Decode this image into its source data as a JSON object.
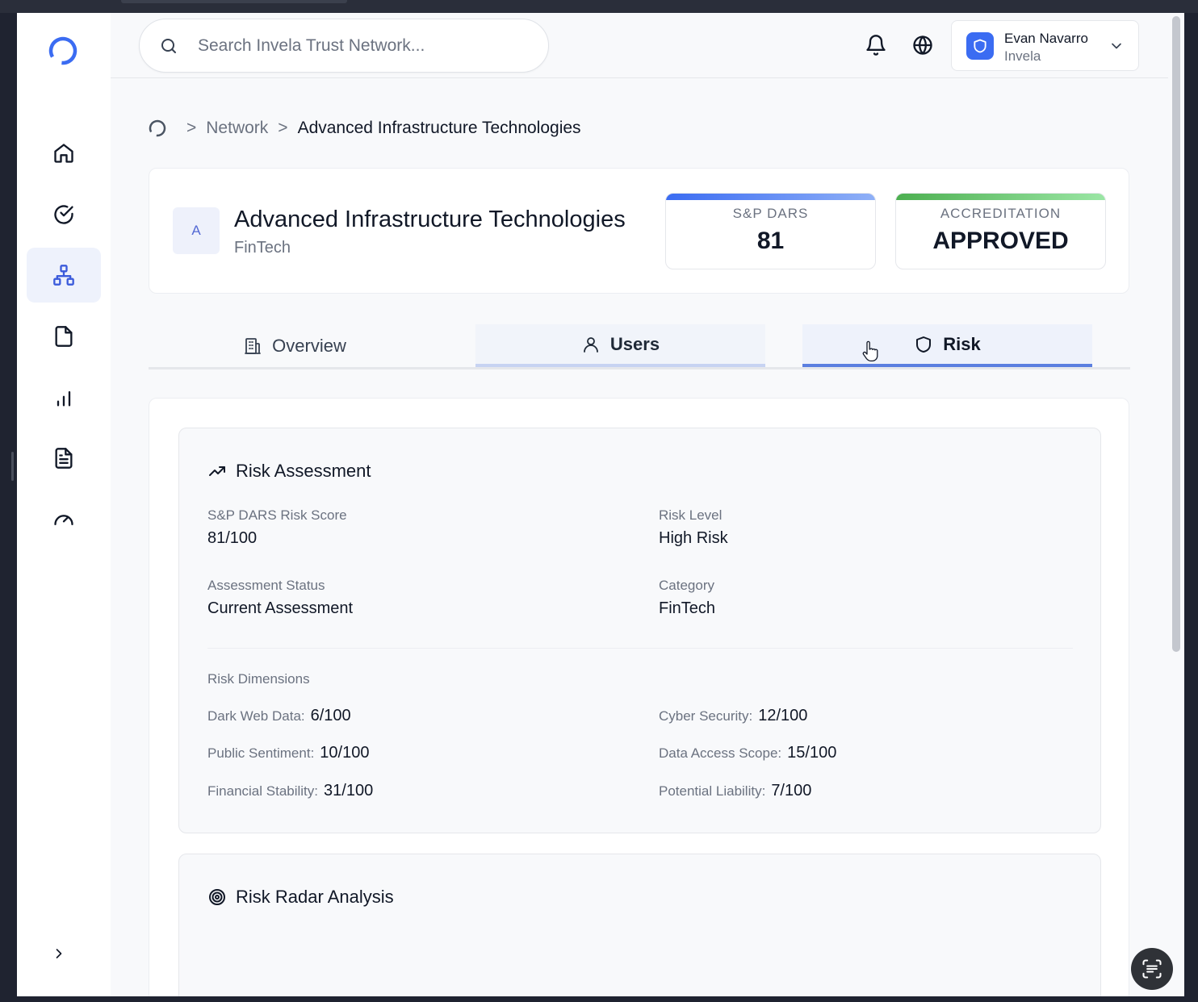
{
  "search": {
    "placeholder": "Search Invela Trust Network..."
  },
  "user": {
    "name": "Evan Navarro",
    "org": "Invela"
  },
  "breadcrumb": {
    "link": "Network",
    "separator": ">",
    "current": "Advanced Infrastructure Technologies"
  },
  "company": {
    "avatar_letter": "A",
    "name": "Advanced Infrastructure Technologies",
    "category": "FinTech",
    "stats": [
      {
        "label": "S&P DARS",
        "value": "81",
        "accent": "#3b6cf2"
      },
      {
        "label": "ACCREDITATION",
        "value": "APPROVED",
        "accent": "#4caf50"
      }
    ]
  },
  "tabs": [
    {
      "label": "Overview",
      "icon": "building-icon"
    },
    {
      "label": "Users",
      "icon": "user-icon"
    },
    {
      "label": "Risk",
      "icon": "shield-icon",
      "active": true
    }
  ],
  "risk_assessment": {
    "title": "Risk Assessment",
    "fields": [
      {
        "label": "S&P DARS Risk Score",
        "value": "81/100"
      },
      {
        "label": "Risk Level",
        "value": "High Risk"
      },
      {
        "label": "Assessment Status",
        "value": "Current Assessment"
      },
      {
        "label": "Category",
        "value": "FinTech"
      }
    ],
    "dimensions_title": "Risk Dimensions",
    "dimensions": [
      {
        "label": "Dark Web Data:",
        "value": "6/100"
      },
      {
        "label": "Cyber Security:",
        "value": "12/100"
      },
      {
        "label": "Public Sentiment:",
        "value": "10/100"
      },
      {
        "label": "Data Access Scope:",
        "value": "15/100"
      },
      {
        "label": "Financial Stability:",
        "value": "31/100"
      },
      {
        "label": "Potential Liability:",
        "value": "7/100"
      }
    ]
  },
  "risk_radar": {
    "title": "Risk Radar Analysis"
  },
  "colors": {
    "accent": "#3b6cf2",
    "approved": "#4caf50",
    "nav_active_bg": "#eef2fc"
  }
}
